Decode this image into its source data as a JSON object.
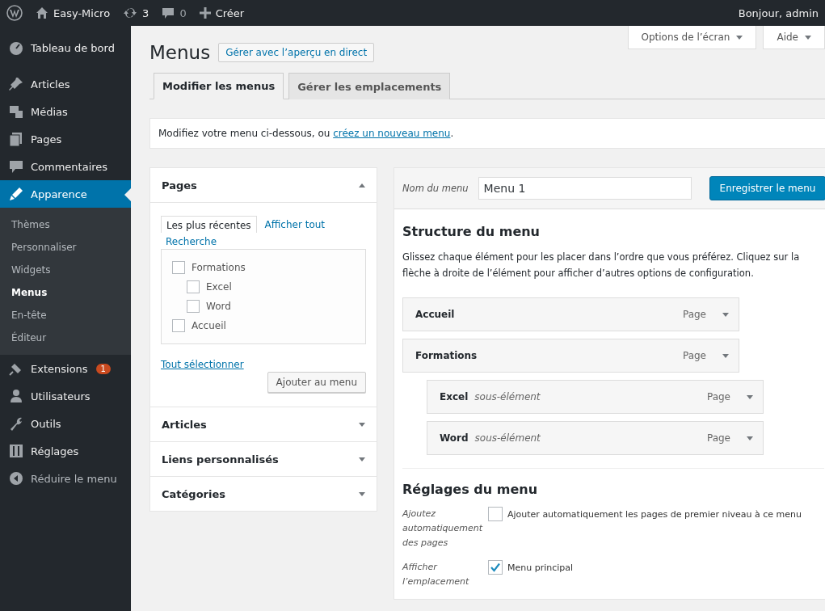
{
  "admin_bar": {
    "site": "Easy-Micro",
    "updates": "3",
    "comments": "0",
    "new": "Créer",
    "greeting": "Bonjour, admin"
  },
  "sidebar": {
    "items": [
      {
        "label": "Tableau de bord",
        "selected": false
      },
      {
        "label": "Articles",
        "selected": false
      },
      {
        "label": "Médias",
        "selected": false
      },
      {
        "label": "Pages",
        "selected": false
      },
      {
        "label": "Commentaires",
        "selected": false
      },
      {
        "label": "Apparence",
        "selected": true,
        "children": [
          {
            "label": "Thèmes",
            "selected": false
          },
          {
            "label": "Personnaliser",
            "selected": false
          },
          {
            "label": "Widgets",
            "selected": false
          },
          {
            "label": "Menus",
            "selected": true
          },
          {
            "label": "En-tête",
            "selected": false
          },
          {
            "label": "Éditeur",
            "selected": false
          }
        ]
      },
      {
        "label": "Extensions",
        "selected": false,
        "badge": "1"
      },
      {
        "label": "Utilisateurs",
        "selected": false
      },
      {
        "label": "Outils",
        "selected": false
      },
      {
        "label": "Réglages",
        "selected": false
      },
      {
        "label": "Réduire le menu",
        "selected": false
      }
    ]
  },
  "screen_tabs": [
    "Options de l’écran",
    "Aide"
  ],
  "page": {
    "title": "Menus",
    "action": "Gérer avec l’aperçu en direct"
  },
  "tabs": [
    {
      "label": "Modifier les menus",
      "selected": true
    },
    {
      "label": "Gérer les emplacements",
      "selected": false
    }
  ],
  "notice": {
    "text": "Modifiez votre menu ci-dessous, ou ",
    "link": "créez un nouveau menu",
    "suffix": "."
  },
  "accordion": [
    {
      "title": "Pages",
      "expanded": true,
      "tabs": [
        {
          "label": "Les plus récentes",
          "selected": true
        },
        {
          "label": "Afficher tout",
          "selected": false
        },
        {
          "label": "Recherche",
          "selected": false
        }
      ],
      "items": [
        {
          "label": "Formations",
          "checked": false,
          "children": [
            {
              "label": "Excel",
              "checked": false
            },
            {
              "label": "Word",
              "checked": false
            }
          ]
        },
        {
          "label": "Accueil",
          "checked": false
        }
      ],
      "select_all": "Tout sélectionner",
      "add_button": "Ajouter au menu"
    },
    {
      "title": "Articles",
      "expanded": false
    },
    {
      "title": "Liens personnalisés",
      "expanded": false
    },
    {
      "title": "Catégories",
      "expanded": false
    }
  ],
  "editor": {
    "name_label": "Nom du menu",
    "name_value": "Menu 1",
    "save_button": "Enregistrer le menu",
    "structure_title": "Structure du menu",
    "structure_help": "Glissez chaque élément pour les placer dans l’ordre que vous préférez. Cliquez sur la flèche à droite de l’élément pour afficher d’autres options de configuration.",
    "items": [
      {
        "title": "Accueil",
        "type": "Page"
      },
      {
        "title": "Formations",
        "type": "Page",
        "children": [
          {
            "title": "Excel",
            "note": "sous-élément",
            "type": "Page"
          },
          {
            "title": "Word",
            "note": "sous-élément",
            "type": "Page"
          }
        ]
      }
    ],
    "settings_title": "Réglages du menu",
    "settings": [
      {
        "label": "Ajoutez automatiquement des pages",
        "options": [
          {
            "label": "Ajouter automatiquement les pages de premier niveau à ce menu",
            "checked": false
          }
        ]
      },
      {
        "label": "Afficher l’emplacement",
        "options": [
          {
            "label": "Menu principal",
            "checked": true
          }
        ]
      }
    ]
  }
}
